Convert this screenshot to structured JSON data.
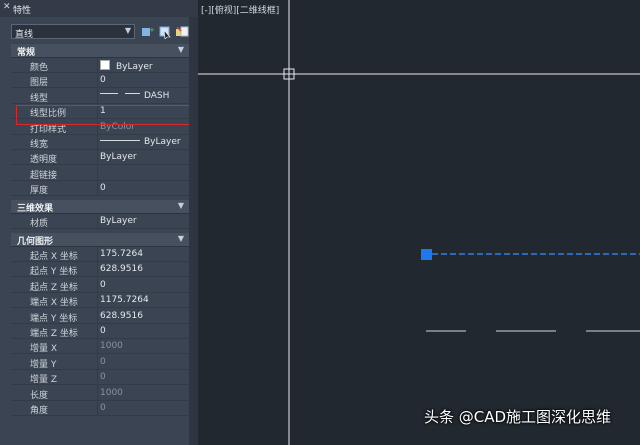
{
  "panel": {
    "title": "特性",
    "object_type": "直线",
    "sections": [
      {
        "title": "常规",
        "rows": [
          {
            "label": "颜色",
            "value": "ByLayer",
            "kind": "color",
            "color": "#ffffff"
          },
          {
            "label": "图层",
            "value": "0"
          },
          {
            "label": "线型",
            "value": "DASH",
            "kind": "linetype"
          },
          {
            "label": "线型比例",
            "value": "1"
          },
          {
            "label": "打印样式",
            "value": "ByColor",
            "disabled": true
          },
          {
            "label": "线宽",
            "value": "ByLayer",
            "kind": "lineweight"
          },
          {
            "label": "透明度",
            "value": "ByLayer"
          },
          {
            "label": "超链接",
            "value": ""
          },
          {
            "label": "厚度",
            "value": "0"
          }
        ]
      },
      {
        "title": "三维效果",
        "rows": [
          {
            "label": "材质",
            "value": "ByLayer"
          }
        ]
      },
      {
        "title": "几何图形",
        "rows": [
          {
            "label": "起点 X 坐标",
            "value": "175.7264"
          },
          {
            "label": "起点 Y 坐标",
            "value": "628.9516"
          },
          {
            "label": "起点 Z 坐标",
            "value": "0"
          },
          {
            "label": "端点 X 坐标",
            "value": "1175.7264"
          },
          {
            "label": "端点 Y 坐标",
            "value": "628.9516"
          },
          {
            "label": "端点 Z 坐标",
            "value": "0"
          },
          {
            "label": "增量 X",
            "value": "1000",
            "disabled": true
          },
          {
            "label": "增量 Y",
            "value": "0",
            "disabled": true
          },
          {
            "label": "增量 Z",
            "value": "0",
            "disabled": true
          },
          {
            "label": "长度",
            "value": "1000",
            "disabled": true
          },
          {
            "label": "角度",
            "value": "0",
            "disabled": true
          }
        ]
      }
    ]
  },
  "viewport": {
    "label": "[-][俯视][二维线框]"
  },
  "watermark": {
    "text": "头条 @CAD施工图深化思维"
  },
  "colors": {
    "panel_bg": "#3b4453",
    "canvas_bg": "#212830",
    "selected_line": "#2f7fe8",
    "highlight_box": "#d8262b"
  }
}
